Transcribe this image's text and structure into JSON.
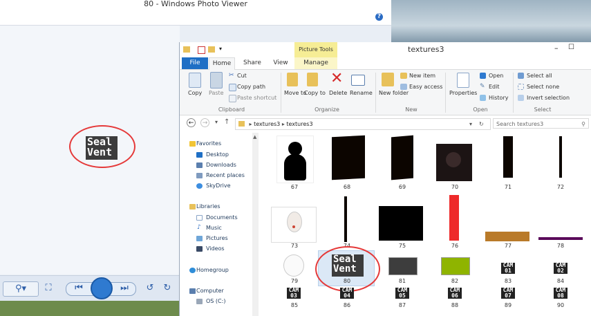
{
  "photo_viewer": {
    "title": "80 - Windows Photo Viewer",
    "help_label": "?",
    "image_text_line1": "Seal",
    "image_text_line2": "Vent"
  },
  "explorer": {
    "title": "textures3",
    "context_tab": "Picture Tools",
    "tabs": [
      "File",
      "Home",
      "Share",
      "View",
      "Manage"
    ],
    "ribbon": {
      "copy": "Copy",
      "paste": "Paste",
      "cut": "Cut",
      "copy_path": "Copy path",
      "paste_shortcut": "Paste shortcut",
      "clipboard": "Clipboard",
      "move_to": "Move to",
      "copy_to": "Copy to",
      "delete": "Delete",
      "rename": "Rename",
      "organize": "Organize",
      "new_item": "New item",
      "easy_access": "Easy access",
      "new_folder": "New folder",
      "new": "New",
      "properties": "Properties",
      "open": "Open",
      "edit": "Edit",
      "history": "History",
      "open_group": "Open",
      "select_all": "Select all",
      "select_none": "Select none",
      "invert_selection": "Invert selection",
      "select": "Select"
    },
    "address": {
      "crumb1": "textures3",
      "crumb2": "textures3",
      "search_placeholder": "Search textures3"
    },
    "nav": {
      "favorites": "Favorites",
      "desktop": "Desktop",
      "downloads": "Downloads",
      "recent_places": "Recent places",
      "skydrive": "SkyDrive",
      "libraries": "Libraries",
      "documents": "Documents",
      "music": "Music",
      "pictures": "Pictures",
      "videos": "Videos",
      "homegroup": "Homegroup",
      "computer": "Computer",
      "os_c": "OS (C:)"
    },
    "files": [
      "67",
      "68",
      "69",
      "70",
      "71",
      "72",
      "73",
      "74",
      "75",
      "76",
      "77",
      "78",
      "79",
      "80",
      "81",
      "82",
      "83",
      "84",
      "85",
      "86",
      "87",
      "88",
      "89",
      "90"
    ],
    "thumb_text": {
      "seal": "Seal",
      "vent": "Vent",
      "cam": "CAM",
      "cam_ids": {
        "83": "01",
        "84": "02",
        "85": "03",
        "86": "04",
        "87": "05",
        "88": "06",
        "89": "07",
        "90": "08"
      }
    }
  }
}
